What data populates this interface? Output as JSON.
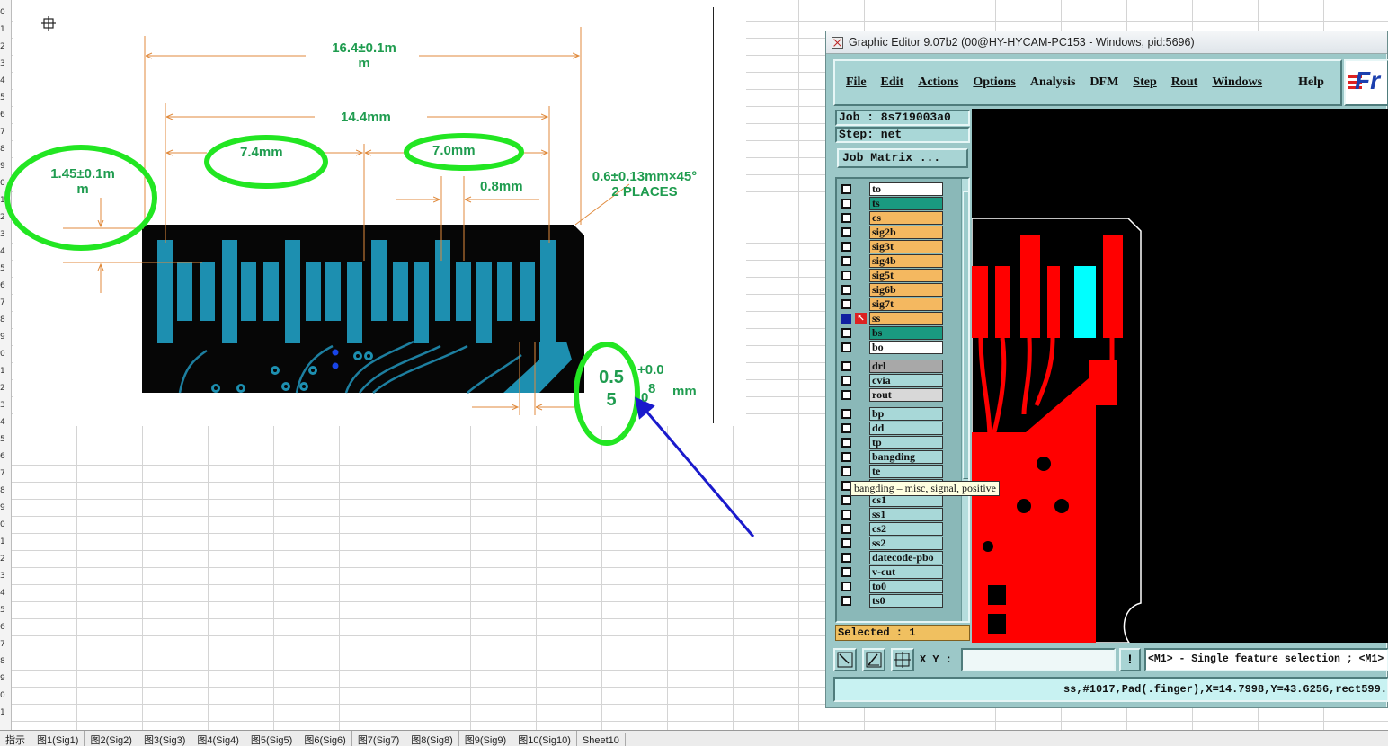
{
  "spreadsheet": {
    "row_numbers": [
      "0",
      "1",
      "2",
      "3",
      "4",
      "5",
      "6",
      "7",
      "8",
      "9",
      "0",
      "1",
      "2",
      "3",
      "4",
      "5",
      "6",
      "7",
      "8",
      "9",
      "0",
      "1",
      "2",
      "3",
      "4",
      "5",
      "6",
      "7",
      "8",
      "9",
      "0",
      "1",
      "2",
      "3",
      "4",
      "5",
      "6",
      "7",
      "8",
      "9",
      "0",
      "1"
    ],
    "sheet_tabs": [
      "指示",
      "图1(Sig1)",
      "图2(Sig2)",
      "图3(Sig3)",
      "图4(Sig4)",
      "图5(Sig5)",
      "图6(Sig6)",
      "图7(Sig7)",
      "图8(Sig8)",
      "图9(Sig9)",
      "图10(Sig10)",
      "Sheet10"
    ]
  },
  "drawing": {
    "dim_total": "16.4±0.1m",
    "dim_total_wrap": "m",
    "dim_14": "14.4mm",
    "dim_74": "7.4mm",
    "dim_70": "7.0mm",
    "dim_08": "0.8mm",
    "dim_chamfer": "0.6±0.13mm×45°",
    "dim_chamfer_places": "2 PLACES",
    "dim_145": "1.45±0.1m",
    "dim_145_wrap": "m",
    "dim_055_a": "0.5",
    "dim_055_b": "5",
    "tol_plus": "+0.0",
    "tol_8": "8",
    "tol_0": "0",
    "tol_unit": "mm"
  },
  "graphic_editor": {
    "title": "Graphic Editor 9.07b2 (00@HY-HYCAM-PC153 - Windows, pid:5696)",
    "menu": [
      "File",
      "Edit",
      "Actions",
      "Options",
      "Analysis",
      "DFM",
      "Step",
      "Rout",
      "Windows",
      "Help"
    ],
    "logo_text": "Fr",
    "job": "Job : 8s719003a0",
    "step": "Step: net",
    "job_matrix_button": "Job Matrix ...",
    "layers": [
      {
        "name": "to",
        "color": "#ffffff"
      },
      {
        "name": "ts",
        "color": "#1a9a80"
      },
      {
        "name": "cs",
        "color": "#f4b860"
      },
      {
        "name": "sig2b",
        "color": "#f4b860"
      },
      {
        "name": "sig3t",
        "color": "#f4b860"
      },
      {
        "name": "sig4b",
        "color": "#f4b860"
      },
      {
        "name": "sig5t",
        "color": "#f4b860"
      },
      {
        "name": "sig6b",
        "color": "#f4b860"
      },
      {
        "name": "sig7t",
        "color": "#f4b860"
      },
      {
        "name": "ss",
        "color": "#f4b860"
      },
      {
        "name": "bs",
        "color": "#1a9a80"
      },
      {
        "name": "bo",
        "color": "#ffffff"
      },
      {
        "name": "drl",
        "color": "#a8a8a8"
      },
      {
        "name": "cvia",
        "color": "#a8d8d8"
      },
      {
        "name": "rout",
        "color": "#d8d8d8"
      },
      {
        "name": "bp",
        "color": "#a8d8d8"
      },
      {
        "name": "dd",
        "color": "#a8d8d8"
      },
      {
        "name": "tp",
        "color": "#a8d8d8"
      },
      {
        "name": "bangding",
        "color": "#a8d8d8"
      },
      {
        "name": "te",
        "color": "#a8d8d8"
      },
      {
        "name": "",
        "color": "#a8d8d8"
      },
      {
        "name": "cs1",
        "color": "#a8d8d8"
      },
      {
        "name": "ss1",
        "color": "#a8d8d8"
      },
      {
        "name": "cs2",
        "color": "#a8d8d8"
      },
      {
        "name": "ss2",
        "color": "#a8d8d8"
      },
      {
        "name": "datecode-pbo",
        "color": "#a8d8d8"
      },
      {
        "name": "v-cut",
        "color": "#a8d8d8"
      },
      {
        "name": "to0",
        "color": "#a8d8d8"
      },
      {
        "name": "ts0",
        "color": "#a8d8d8"
      }
    ],
    "selected": "Selected : 1",
    "xy_label": "X Y :",
    "xy_value": "",
    "hint": "<M1> - Single feature selection ; <M1>",
    "status": "ss,#1017,Pad(.finger),X=14.7998,Y=43.6256,rect599.",
    "tooltip": "bangding – misc, signal, positive"
  }
}
